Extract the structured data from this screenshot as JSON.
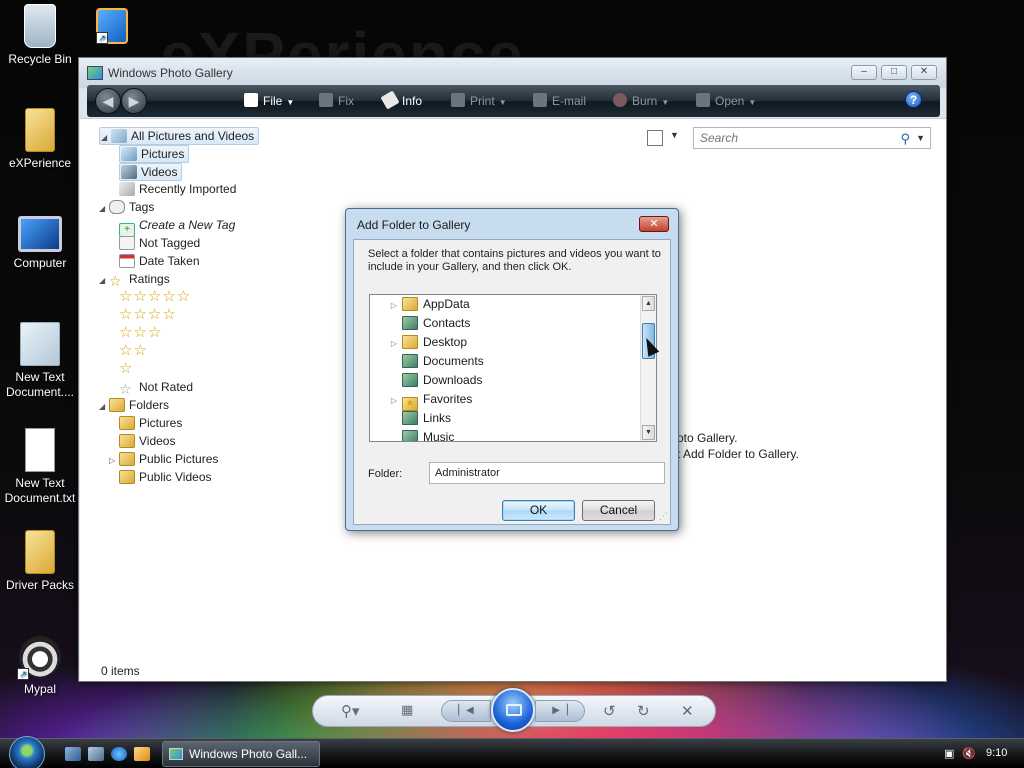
{
  "desktop": {
    "wallpaper_text": "eXPerience",
    "icons": [
      {
        "label": "Recycle Bin",
        "icon": "recycle-bin-icon"
      },
      {
        "label": "eXPerience",
        "icon": "folder-icon"
      },
      {
        "label": "Computer",
        "icon": "computer-icon"
      },
      {
        "label": "New Text Document....",
        "icon": "settings-document-icon"
      },
      {
        "label": "New Text Document.txt",
        "icon": "text-document-icon"
      },
      {
        "label": "Driver Packs",
        "icon": "folder-icon"
      },
      {
        "label": "Mypal",
        "icon": "raccoon-icon"
      }
    ]
  },
  "window": {
    "title": "Windows Photo Gallery",
    "controls": {
      "minimize": "–",
      "maximize": "□",
      "close": "✕"
    },
    "toolbar": {
      "back": "◀",
      "forward": "▶",
      "file": "File",
      "fix": "Fix",
      "info": "Info",
      "print": "Print",
      "email": "E-mail",
      "burn": "Burn",
      "open": "Open",
      "help": "?"
    },
    "search": {
      "placeholder": "Search"
    },
    "nav": {
      "all_pictures": "All Pictures and Videos",
      "pictures": "Pictures",
      "videos": "Videos",
      "recently_imported": "Recently Imported",
      "tags": "Tags",
      "create_tag": "Create a New Tag",
      "not_tagged": "Not Tagged",
      "date_taken": "Date Taken",
      "ratings": "Ratings",
      "rating_levels": [
        5,
        4,
        3,
        2,
        1
      ],
      "not_rated": "Not Rated",
      "folders": "Folders",
      "folder_pictures": "Pictures",
      "folder_videos": "Videos",
      "public_pictures": "Public Pictures",
      "public_videos": "Public Videos"
    },
    "hint_line1": "oto Gallery.",
    "hint_line2": "t Add Folder to Gallery.",
    "status": "0 items"
  },
  "dialog": {
    "title": "Add Folder to Gallery",
    "close": "✕",
    "message": "Select a folder that contains pictures and videos you want to include in your Gallery, and then click OK.",
    "tree": [
      {
        "label": "AppData",
        "expandable": true,
        "icon": "folder"
      },
      {
        "label": "Contacts",
        "expandable": false,
        "icon": "special"
      },
      {
        "label": "Desktop",
        "expandable": true,
        "icon": "folder"
      },
      {
        "label": "Documents",
        "expandable": false,
        "icon": "special"
      },
      {
        "label": "Downloads",
        "expandable": false,
        "icon": "special"
      },
      {
        "label": "Favorites",
        "expandable": true,
        "icon": "star"
      },
      {
        "label": "Links",
        "expandable": false,
        "icon": "special"
      },
      {
        "label": "Music",
        "expandable": false,
        "icon": "special"
      }
    ],
    "folder_label": "Folder:",
    "folder_value": "Administrator",
    "ok": "OK",
    "cancel": "Cancel"
  },
  "taskbar": {
    "task": "Windows Photo Gall...",
    "clock": "9:10"
  },
  "colors": {
    "accent": "#3c7fb1",
    "toolbar_dark": "#1e2a34",
    "dialog_frame": "#c8dcef"
  }
}
